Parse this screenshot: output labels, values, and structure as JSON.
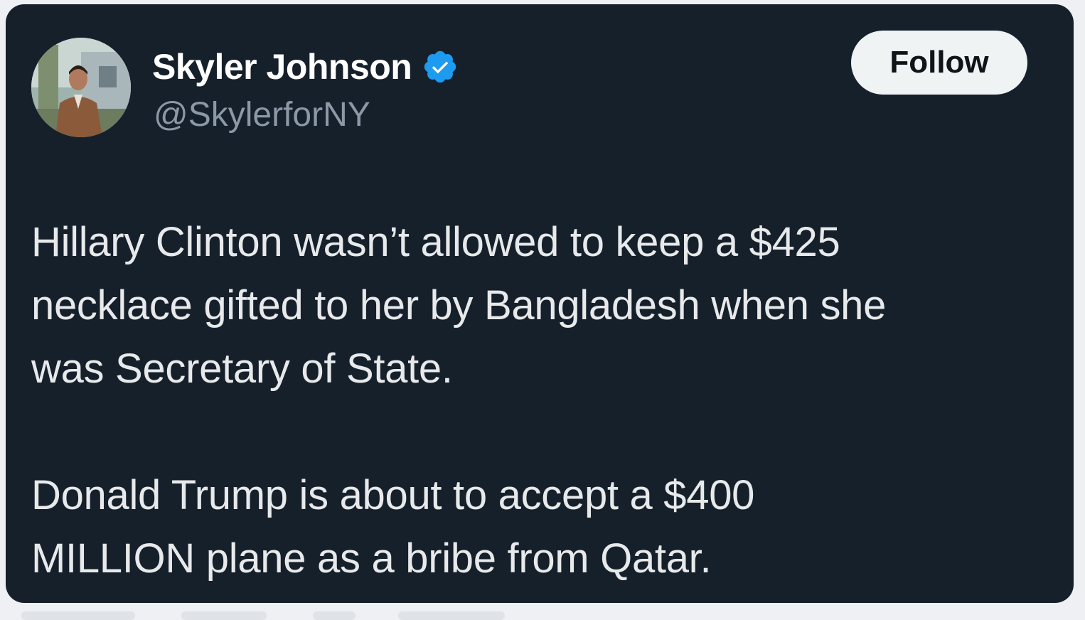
{
  "author": {
    "display_name": "Skyler Johnson",
    "handle": "@SkylerforNY",
    "verified": true,
    "avatar_icon": "profile-photo"
  },
  "actions": {
    "follow_label": "Follow"
  },
  "tweet": {
    "paragraphs": [
      "Hillary Clinton wasn’t allowed to keep a $425\nnecklace gifted to her by Bangladesh when she\nwas Secretary of State.",
      "Donald Trump is about to accept a $400\nMILLION plane as a bribe from Qatar."
    ]
  },
  "colors": {
    "card_background": "#16202b",
    "verified_badge": "#1d9bf0",
    "handle_text": "#8b98a5",
    "body_text": "#e7e9ea"
  }
}
